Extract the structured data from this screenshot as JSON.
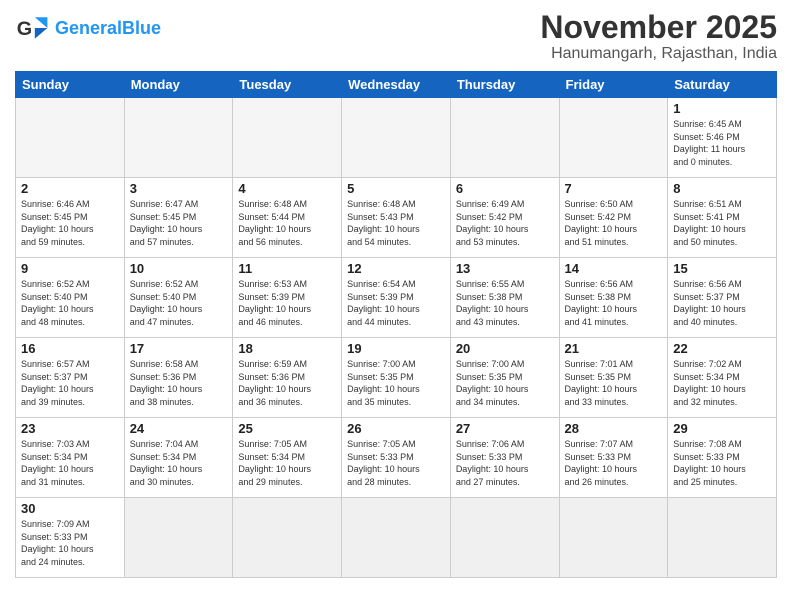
{
  "header": {
    "logo_general": "General",
    "logo_blue": "Blue",
    "month": "November 2025",
    "location": "Hanumangarh, Rajasthan, India"
  },
  "days_of_week": [
    "Sunday",
    "Monday",
    "Tuesday",
    "Wednesday",
    "Thursday",
    "Friday",
    "Saturday"
  ],
  "weeks": [
    [
      {
        "day": "",
        "info": ""
      },
      {
        "day": "",
        "info": ""
      },
      {
        "day": "",
        "info": ""
      },
      {
        "day": "",
        "info": ""
      },
      {
        "day": "",
        "info": ""
      },
      {
        "day": "",
        "info": ""
      },
      {
        "day": "1",
        "info": "Sunrise: 6:45 AM\nSunset: 5:46 PM\nDaylight: 11 hours\nand 0 minutes."
      }
    ],
    [
      {
        "day": "2",
        "info": "Sunrise: 6:46 AM\nSunset: 5:45 PM\nDaylight: 10 hours\nand 59 minutes."
      },
      {
        "day": "3",
        "info": "Sunrise: 6:47 AM\nSunset: 5:45 PM\nDaylight: 10 hours\nand 57 minutes."
      },
      {
        "day": "4",
        "info": "Sunrise: 6:48 AM\nSunset: 5:44 PM\nDaylight: 10 hours\nand 56 minutes."
      },
      {
        "day": "5",
        "info": "Sunrise: 6:48 AM\nSunset: 5:43 PM\nDaylight: 10 hours\nand 54 minutes."
      },
      {
        "day": "6",
        "info": "Sunrise: 6:49 AM\nSunset: 5:42 PM\nDaylight: 10 hours\nand 53 minutes."
      },
      {
        "day": "7",
        "info": "Sunrise: 6:50 AM\nSunset: 5:42 PM\nDaylight: 10 hours\nand 51 minutes."
      },
      {
        "day": "8",
        "info": "Sunrise: 6:51 AM\nSunset: 5:41 PM\nDaylight: 10 hours\nand 50 minutes."
      }
    ],
    [
      {
        "day": "9",
        "info": "Sunrise: 6:52 AM\nSunset: 5:40 PM\nDaylight: 10 hours\nand 48 minutes."
      },
      {
        "day": "10",
        "info": "Sunrise: 6:52 AM\nSunset: 5:40 PM\nDaylight: 10 hours\nand 47 minutes."
      },
      {
        "day": "11",
        "info": "Sunrise: 6:53 AM\nSunset: 5:39 PM\nDaylight: 10 hours\nand 46 minutes."
      },
      {
        "day": "12",
        "info": "Sunrise: 6:54 AM\nSunset: 5:39 PM\nDaylight: 10 hours\nand 44 minutes."
      },
      {
        "day": "13",
        "info": "Sunrise: 6:55 AM\nSunset: 5:38 PM\nDaylight: 10 hours\nand 43 minutes."
      },
      {
        "day": "14",
        "info": "Sunrise: 6:56 AM\nSunset: 5:38 PM\nDaylight: 10 hours\nand 41 minutes."
      },
      {
        "day": "15",
        "info": "Sunrise: 6:56 AM\nSunset: 5:37 PM\nDaylight: 10 hours\nand 40 minutes."
      }
    ],
    [
      {
        "day": "16",
        "info": "Sunrise: 6:57 AM\nSunset: 5:37 PM\nDaylight: 10 hours\nand 39 minutes."
      },
      {
        "day": "17",
        "info": "Sunrise: 6:58 AM\nSunset: 5:36 PM\nDaylight: 10 hours\nand 38 minutes."
      },
      {
        "day": "18",
        "info": "Sunrise: 6:59 AM\nSunset: 5:36 PM\nDaylight: 10 hours\nand 36 minutes."
      },
      {
        "day": "19",
        "info": "Sunrise: 7:00 AM\nSunset: 5:35 PM\nDaylight: 10 hours\nand 35 minutes."
      },
      {
        "day": "20",
        "info": "Sunrise: 7:00 AM\nSunset: 5:35 PM\nDaylight: 10 hours\nand 34 minutes."
      },
      {
        "day": "21",
        "info": "Sunrise: 7:01 AM\nSunset: 5:35 PM\nDaylight: 10 hours\nand 33 minutes."
      },
      {
        "day": "22",
        "info": "Sunrise: 7:02 AM\nSunset: 5:34 PM\nDaylight: 10 hours\nand 32 minutes."
      }
    ],
    [
      {
        "day": "23",
        "info": "Sunrise: 7:03 AM\nSunset: 5:34 PM\nDaylight: 10 hours\nand 31 minutes."
      },
      {
        "day": "24",
        "info": "Sunrise: 7:04 AM\nSunset: 5:34 PM\nDaylight: 10 hours\nand 30 minutes."
      },
      {
        "day": "25",
        "info": "Sunrise: 7:05 AM\nSunset: 5:34 PM\nDaylight: 10 hours\nand 29 minutes."
      },
      {
        "day": "26",
        "info": "Sunrise: 7:05 AM\nSunset: 5:33 PM\nDaylight: 10 hours\nand 28 minutes."
      },
      {
        "day": "27",
        "info": "Sunrise: 7:06 AM\nSunset: 5:33 PM\nDaylight: 10 hours\nand 27 minutes."
      },
      {
        "day": "28",
        "info": "Sunrise: 7:07 AM\nSunset: 5:33 PM\nDaylight: 10 hours\nand 26 minutes."
      },
      {
        "day": "29",
        "info": "Sunrise: 7:08 AM\nSunset: 5:33 PM\nDaylight: 10 hours\nand 25 minutes."
      }
    ],
    [
      {
        "day": "30",
        "info": "Sunrise: 7:09 AM\nSunset: 5:33 PM\nDaylight: 10 hours\nand 24 minutes."
      },
      {
        "day": "",
        "info": ""
      },
      {
        "day": "",
        "info": ""
      },
      {
        "day": "",
        "info": ""
      },
      {
        "day": "",
        "info": ""
      },
      {
        "day": "",
        "info": ""
      },
      {
        "day": "",
        "info": ""
      }
    ]
  ]
}
